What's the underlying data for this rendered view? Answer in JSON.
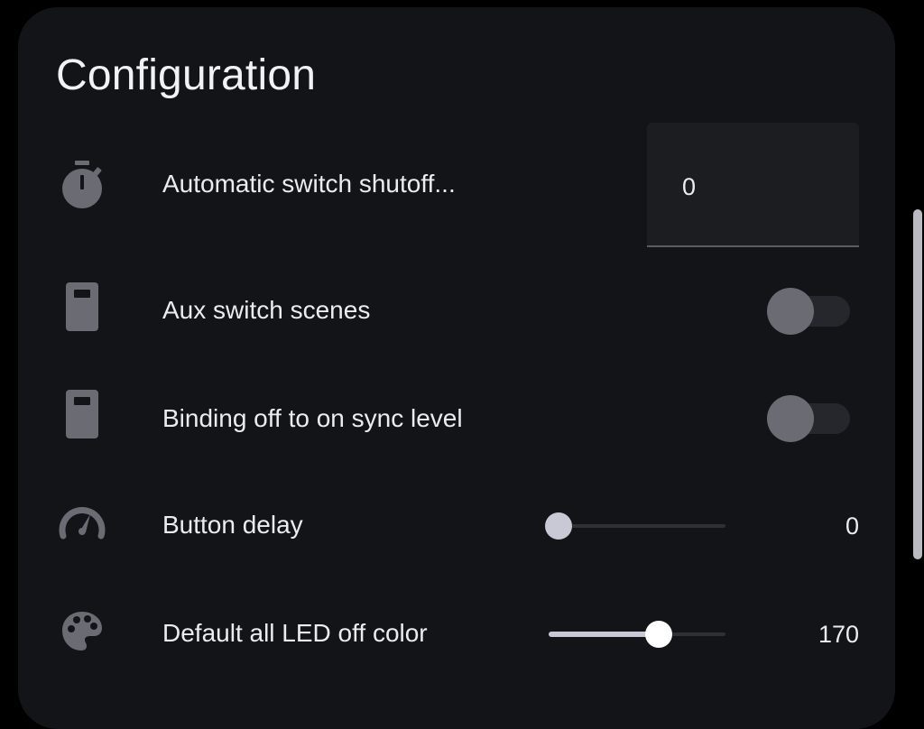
{
  "title": "Configuration",
  "rows": [
    {
      "icon": "timer-icon",
      "label": "Automatic switch shutoff...",
      "control": "textfield",
      "value": "0"
    },
    {
      "icon": "switch-icon",
      "label": "Aux switch scenes",
      "control": "toggle",
      "checked": false
    },
    {
      "icon": "switch-icon",
      "label": "Binding off to on sync level",
      "control": "toggle",
      "checked": false
    },
    {
      "icon": "speedometer-icon",
      "label": "Button delay",
      "control": "slider",
      "value": "0",
      "fraction": 0.0
    },
    {
      "icon": "palette-icon",
      "label": "Default all LED off color",
      "control": "slider",
      "value": "170",
      "fraction": 0.667
    }
  ],
  "colors": {
    "background": "#000000",
    "card": "#131418",
    "icon": "#6b6b74",
    "text": "#ececef",
    "slider_active": "#c8c9d4"
  }
}
